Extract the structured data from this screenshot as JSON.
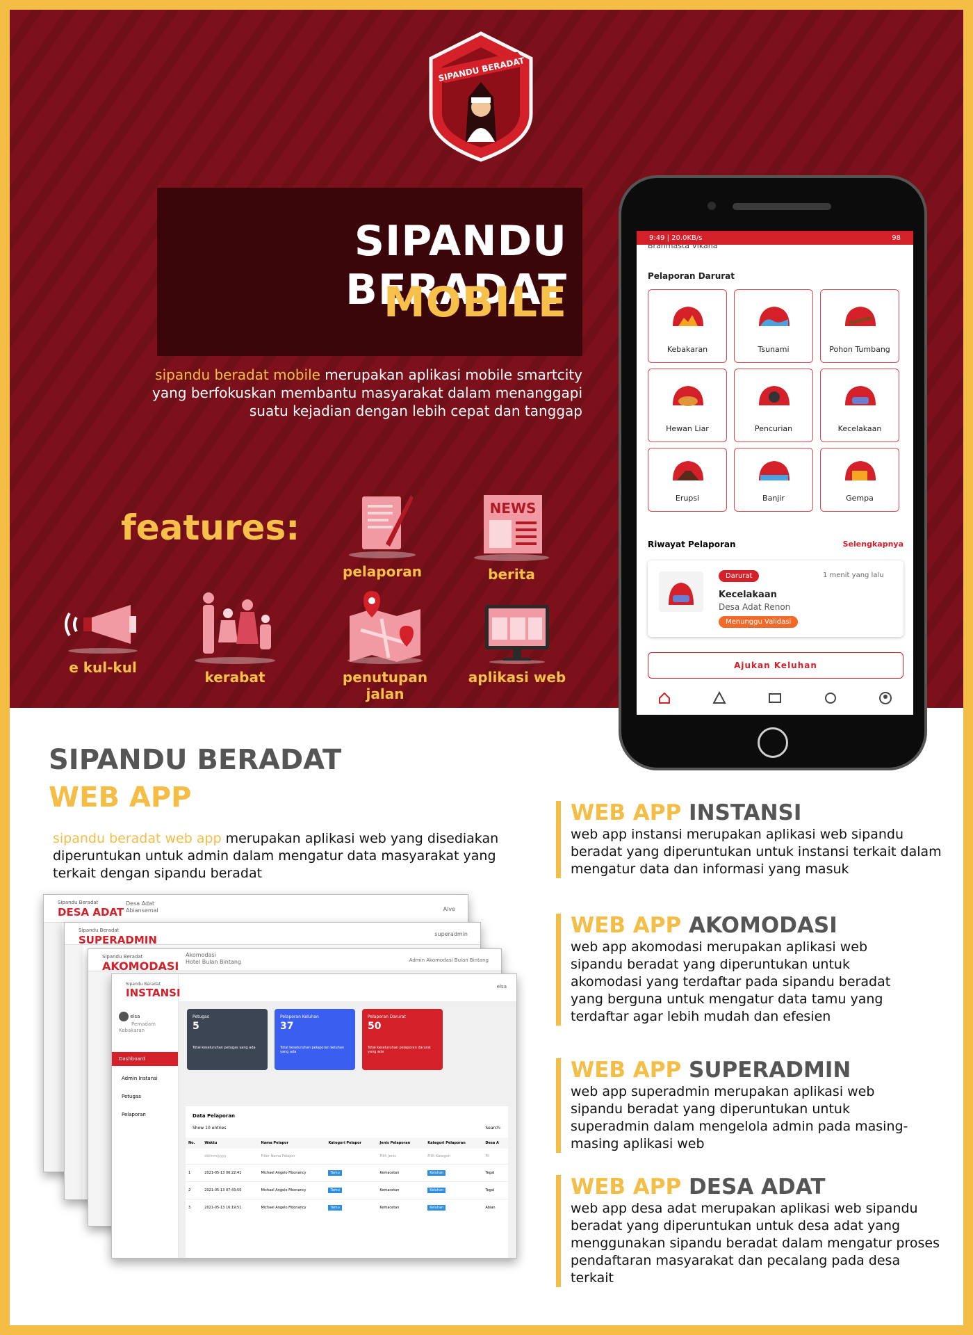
{
  "hero": {
    "logo_text": "SIPANDU BERADAT",
    "title_line1": "SIPANDU BERADAT",
    "title_line2": "MOBILE",
    "desc_highlight": "sipandu beradat mobile",
    "desc_rest": " merupakan aplikasi mobile smartcity yang berfokuskan membantu masyarakat dalam menanggapi suatu kejadian dengan lebih cepat dan tanggap"
  },
  "features": {
    "title": "features:",
    "items": [
      {
        "label": "pelaporan",
        "icon": "document-pen-icon"
      },
      {
        "label": "berita",
        "icon": "newspaper-icon"
      },
      {
        "label": "e kul-kul",
        "icon": "megaphone-icon"
      },
      {
        "label": "kerabat",
        "icon": "family-icon"
      },
      {
        "label": "penutupan jalan",
        "icon": "map-pin-icon"
      },
      {
        "label": "aplikasi web",
        "icon": "monitor-icon"
      }
    ]
  },
  "phone": {
    "status_left": "9:49 | 20.0KB/s",
    "status_right": "98",
    "cut_text": "Brahmasta Vikana",
    "emergency_title": "Pelaporan Darurat",
    "emergency_items": [
      "Kebakaran",
      "Tsunami",
      "Pohon Tumbang",
      "Hewan Liar",
      "Pencurian",
      "Kecelakaan",
      "Erupsi",
      "Banjir",
      "Gempa"
    ],
    "history_title": "Riwayat Pelaporan",
    "history_more": "Selengkapnya",
    "report": {
      "badge": "Darurat",
      "time": "1 menit yang lalu",
      "title": "Kecelakaan",
      "subtitle": "Desa Adat Renon",
      "status": "Menunggu Validasi"
    },
    "submit_label": "Ajukan Keluhan",
    "nav_icons": [
      "home-icon",
      "warning-icon",
      "news-icon",
      "chat-icon",
      "profile-icon"
    ]
  },
  "web": {
    "title_line1": "SIPANDU BERADAT",
    "title_line2": "WEB APP",
    "desc_highlight": "sipandu beradat web app",
    "desc_rest": " merupakan aplikasi web yang disediakan diperuntukan untuk admin dalam mengatur data masyarakat yang terkait dengan sipandu beradat",
    "apps": [
      {
        "prefix": "WEB APP",
        "name": "INSTANSI",
        "text": "web app instansi merupakan aplikasi web sipandu beradat yang diperuntukan untuk instansi terkait dalam mengatur data dan informasi yang masuk"
      },
      {
        "prefix": "WEB APP",
        "name": "AKOMODASI",
        "text": "web app akomodasi  merupakan aplikasi web sipandu beradat yang diperuntukan untuk akomodasi yang terdaftar pada sipandu beradat yang berguna untuk mengatur data tamu yang terdaftar agar lebih mudah dan efesien"
      },
      {
        "prefix": "WEB APP",
        "name": "SUPERADMIN",
        "text": "web app superadmin merupakan aplikasi web sipandu beradat yang diperuntukan untuk superadmin dalam mengelola admin pada masing-masing aplikasi web"
      },
      {
        "prefix": "WEB APP",
        "name": "DESA ADAT",
        "text": "web app desa adat merupakan aplikasi web sipandu beradat yang diperuntukan untuk desa adat yang menggunakan sipandu beradat dalam mengatur proses pendaftaran masyarakat dan pecalang pada desa terkait"
      }
    ]
  },
  "mock": {
    "brand_small": "Sipandu Beradat",
    "windows": [
      {
        "brand": "DESA ADAT",
        "sub1": "Desa Adat",
        "sub2": "Abiansemal",
        "user": "Alve"
      },
      {
        "brand": "SUPERADMIN",
        "sub1": "",
        "sub2": "",
        "user": "superadmin"
      },
      {
        "brand": "AKOMODASI",
        "sub1": "Akomodasi",
        "sub2": "Hotel Bulan Bintang",
        "user": "Admin Akomodasi Bulan Bintang"
      },
      {
        "brand": "INSTANSI",
        "sub1": "",
        "sub2": "",
        "user": "elsa"
      }
    ],
    "profile_name": "elsa",
    "profile_role": "Pemadam Kebakaran",
    "menu": [
      "Dashboard",
      "Admin Instansi",
      "Petugas",
      "Pelaporan"
    ],
    "stats": [
      {
        "label": "Petugas",
        "value": "5",
        "foot": "Total keseluruhan petugas yang ada",
        "color": "#3c4553"
      },
      {
        "label": "Pelaporan Keluhan",
        "value": "37",
        "foot": "Total keseluruhan pelaporan keluhan yang ada",
        "color": "#3a5ef0"
      },
      {
        "label": "Pelaporan Darurat",
        "value": "50",
        "foot": "Total keseluruhan pelaporan darurat yang ada",
        "color": "#d32029"
      }
    ],
    "table_title": "Data Pelaporan",
    "show": "Show",
    "entries": "entries",
    "show_count": "10",
    "search": "Search:",
    "columns": [
      "No.",
      "Waktu",
      "Nama Pelapor",
      "Kategori Pelapor",
      "Jenis Pelaporan",
      "Kategori Pelaporan",
      "Desa A"
    ],
    "filters": [
      "dd/mm/yyyy",
      "Filter Nama Pelapor",
      "Pilih Jenis",
      "Pilih Kategori",
      "Pil"
    ],
    "rows": [
      [
        "1",
        "2021-05-13 06:22:41",
        "Michael Angelo Fibonancy",
        "Tamu",
        "Kemacetan",
        "Keluhan",
        "Tegal"
      ],
      [
        "2",
        "2021-05-13 07:43:50",
        "Michael Angelo Fibonancy",
        "Tamu",
        "Kemacetan",
        "Keluhan",
        "Tegal"
      ],
      [
        "3",
        "2021-05-13 16:19:51",
        "Michael Angelo Fibonancy",
        "Tamu",
        "Kemacetan",
        "Keluhan",
        "Abian"
      ]
    ]
  },
  "colors": {
    "brand_red": "#7c111b",
    "accent_gold": "#f3bd46",
    "app_red": "#d32029"
  }
}
